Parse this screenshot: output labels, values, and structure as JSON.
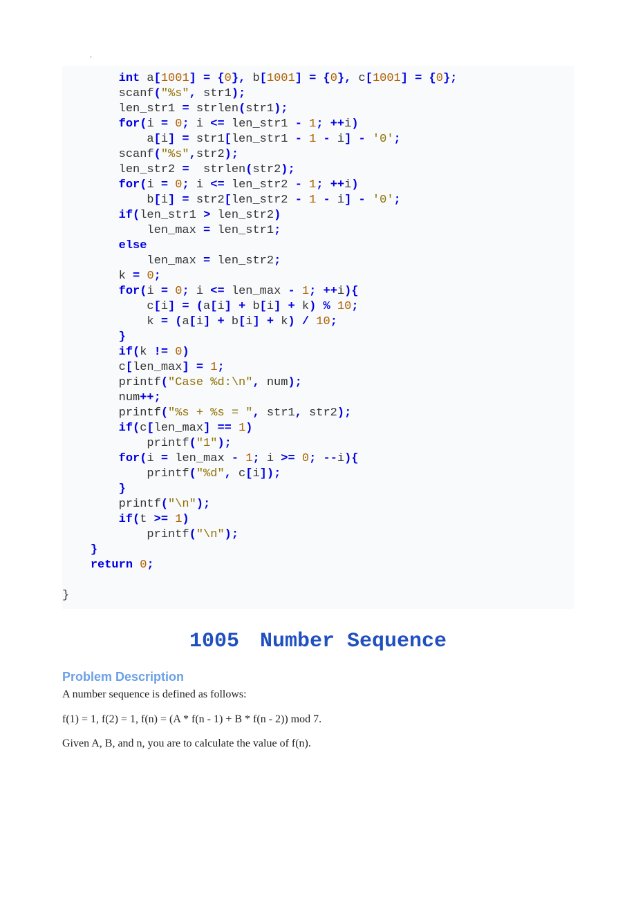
{
  "dot": ".",
  "code": {
    "l01a": "        ",
    "l01_kw1": "int",
    "l01b": " a",
    "l01_op1": "[",
    "l01_n1": "1001",
    "l01_op2": "] = {",
    "l01_n2": "0",
    "l01_op3": "},",
    "l01c": " b",
    "l01_op4": "[",
    "l01_n3": "1001",
    "l01_op5": "] = {",
    "l01_n4": "0",
    "l01_op6": "},",
    "l01d": " c",
    "l01_op7": "[",
    "l01_n5": "1001",
    "l01_op8": "] = {",
    "l01_n6": "0",
    "l01_op9": "};",
    "l02a": "        scanf",
    "l02_op1": "(",
    "l02_s": "\"%s\"",
    "l02_op2": ",",
    "l02b": " str1",
    "l02_op3": ");",
    "l03a": "        len_str1 ",
    "l03_op1": "=",
    "l03b": " strlen",
    "l03_op2": "(",
    "l03c": "str1",
    "l03_op3": ");",
    "l04a": "        ",
    "l04_kw": "for",
    "l04_op1": "(",
    "l04b": "i ",
    "l04_op2": "=",
    "l04c": " ",
    "l04_n1": "0",
    "l04_op3": ";",
    "l04d": " i ",
    "l04_op4": "<=",
    "l04e": " len_str1 ",
    "l04_op5": "-",
    "l04f": " ",
    "l04_n2": "1",
    "l04_op6": "; ++",
    "l04g": "i",
    "l04_op7": ")",
    "l05a": "            a",
    "l05_op1": "[",
    "l05b": "i",
    "l05_op2": "] =",
    "l05c": " str1",
    "l05_op3": "[",
    "l05d": "len_str1 ",
    "l05_op4": "-",
    "l05e": " ",
    "l05_n1": "1",
    "l05f": " ",
    "l05_op5": "-",
    "l05g": " i",
    "l05_op6": "] -",
    "l05h": " ",
    "l05_ch": "'0'",
    "l05_op7": ";",
    "l06a": "        scanf",
    "l06_op1": "(",
    "l06_s": "\"%s\"",
    "l06_op2": ",",
    "l06b": "str2",
    "l06_op3": ");",
    "l07a": "        len_str2 ",
    "l07_op1": "=",
    "l07b": "  strlen",
    "l07_op2": "(",
    "l07c": "str2",
    "l07_op3": ");",
    "l08a": "        ",
    "l08_kw": "for",
    "l08_op1": "(",
    "l08b": "i ",
    "l08_op2": "=",
    "l08c": " ",
    "l08_n1": "0",
    "l08_op3": ";",
    "l08d": " i ",
    "l08_op4": "<=",
    "l08e": " len_str2 ",
    "l08_op5": "-",
    "l08f": " ",
    "l08_n2": "1",
    "l08_op6": "; ++",
    "l08g": "i",
    "l08_op7": ")",
    "l09a": "            b",
    "l09_op1": "[",
    "l09b": "i",
    "l09_op2": "] =",
    "l09c": " str2",
    "l09_op3": "[",
    "l09d": "len_str2 ",
    "l09_op4": "-",
    "l09e": " ",
    "l09_n1": "1",
    "l09f": " ",
    "l09_op5": "-",
    "l09g": " i",
    "l09_op6": "] -",
    "l09h": " ",
    "l09_ch": "'0'",
    "l09_op7": ";",
    "l10a": "        ",
    "l10_kw": "if",
    "l10_op1": "(",
    "l10b": "len_str1 ",
    "l10_op2": ">",
    "l10c": " len_str2",
    "l10_op3": ")",
    "l11a": "            len_max ",
    "l11_op1": "=",
    "l11b": " len_str1",
    "l11_op2": ";",
    "l12a": "        ",
    "l12_kw": "else",
    "l13a": "            len_max ",
    "l13_op1": "=",
    "l13b": " len_str2",
    "l13_op2": ";",
    "l14a": "        k ",
    "l14_op1": "=",
    "l14b": " ",
    "l14_n": "0",
    "l14_op2": ";",
    "l15a": "        ",
    "l15_kw": "for",
    "l15_op1": "(",
    "l15b": "i ",
    "l15_op2": "=",
    "l15c": " ",
    "l15_n1": "0",
    "l15_op3": ";",
    "l15d": " i ",
    "l15_op4": "<=",
    "l15e": " len_max ",
    "l15_op5": "-",
    "l15f": " ",
    "l15_n2": "1",
    "l15_op6": "; ++",
    "l15g": "i",
    "l15_op7": "){",
    "l16a": "            c",
    "l16_op1": "[",
    "l16b": "i",
    "l16_op2": "] = (",
    "l16c": "a",
    "l16_op3": "[",
    "l16d": "i",
    "l16_op4": "] +",
    "l16e": " b",
    "l16_op5": "[",
    "l16f": "i",
    "l16_op6": "] +",
    "l16g": " k",
    "l16_op7": ") %",
    "l16h": " ",
    "l16_n": "10",
    "l16_op8": ";",
    "l17a": "            k ",
    "l17_op1": "= (",
    "l17b": "a",
    "l17_op2": "[",
    "l17c": "i",
    "l17_op3": "] +",
    "l17d": " b",
    "l17_op4": "[",
    "l17e": "i",
    "l17_op5": "] +",
    "l17f": " k",
    "l17_op6": ") /",
    "l17g": " ",
    "l17_n": "10",
    "l17_op7": ";",
    "l18a": "        ",
    "l18_op": "}",
    "l19a": "        ",
    "l19_kw": "if",
    "l19_op1": "(",
    "l19b": "k ",
    "l19_op2": "!=",
    "l19c": " ",
    "l19_n": "0",
    "l19_op3": ")",
    "l20a": "        c",
    "l20_op1": "[",
    "l20b": "len_max",
    "l20_op2": "] =",
    "l20c": " ",
    "l20_n": "1",
    "l20_op3": ";",
    "l21a": "        printf",
    "l21_op1": "(",
    "l21_s": "\"Case %d:\\n\"",
    "l21_op2": ",",
    "l21b": " num",
    "l21_op3": ");",
    "l22a": "        num",
    "l22_op1": "++;",
    "l23a": "        printf",
    "l23_op1": "(",
    "l23_s": "\"%s + %s = \"",
    "l23_op2": ",",
    "l23b": " str1",
    "l23_op3": ",",
    "l23c": " str2",
    "l23_op4": ");",
    "l24a": "        ",
    "l24_kw": "if",
    "l24_op1": "(",
    "l24b": "c",
    "l24_op2": "[",
    "l24c": "len_max",
    "l24_op3": "] ==",
    "l24d": " ",
    "l24_n": "1",
    "l24_op4": ")",
    "l25a": "            printf",
    "l25_op1": "(",
    "l25_s": "\"1\"",
    "l25_op2": ");",
    "l26a": "        ",
    "l26_kw": "for",
    "l26_op1": "(",
    "l26b": "i ",
    "l26_op2": "=",
    "l26c": " len_max ",
    "l26_op3": "-",
    "l26d": " ",
    "l26_n1": "1",
    "l26_op4": ";",
    "l26e": " i ",
    "l26_op5": ">=",
    "l26f": " ",
    "l26_n2": "0",
    "l26_op6": "; --",
    "l26g": "i",
    "l26_op7": "){",
    "l27a": "            printf",
    "l27_op1": "(",
    "l27_s": "\"%d\"",
    "l27_op2": ",",
    "l27b": " c",
    "l27_op3": "[",
    "l27c": "i",
    "l27_op4": "]);",
    "l28a": "        ",
    "l28_op": "}",
    "l29a": "        printf",
    "l29_op1": "(",
    "l29_s": "\"\\n\"",
    "l29_op2": ");",
    "l30a": "        ",
    "l30_kw": "if",
    "l30_op1": "(",
    "l30b": "t ",
    "l30_op2": ">=",
    "l30c": " ",
    "l30_n": "1",
    "l30_op3": ")",
    "l31a": "            printf",
    "l31_op1": "(",
    "l31_s": "\"\\n\"",
    "l31_op2": ");",
    "l32a": "    ",
    "l32_op": "}",
    "l33a": "    ",
    "l33_kw": "return",
    "l33b": " ",
    "l33_n": "0",
    "l33_op": ";",
    "blank": "",
    "l34": "}"
  },
  "title": "1005 Number Sequence",
  "section_head": "Problem Description",
  "p1": "A number sequence is defined as follows:",
  "p2": "f(1) = 1, f(2) = 1, f(n) = (A * f(n - 1) + B * f(n - 2)) mod 7.",
  "p3": "Given A, B, and n, you are to calculate the value of f(n)."
}
